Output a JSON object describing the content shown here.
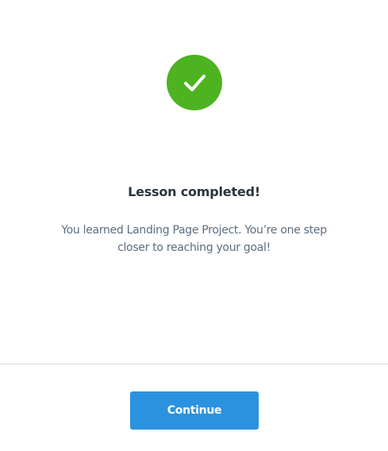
{
  "success": {
    "icon": "checkmark-circle-icon",
    "color": "#4db320"
  },
  "title": "Lesson completed!",
  "message": "You learned Landing Page Project. You’re one step closer to reaching your goal!",
  "continue_button": {
    "label": "Continue",
    "color": "#2b92e0"
  }
}
